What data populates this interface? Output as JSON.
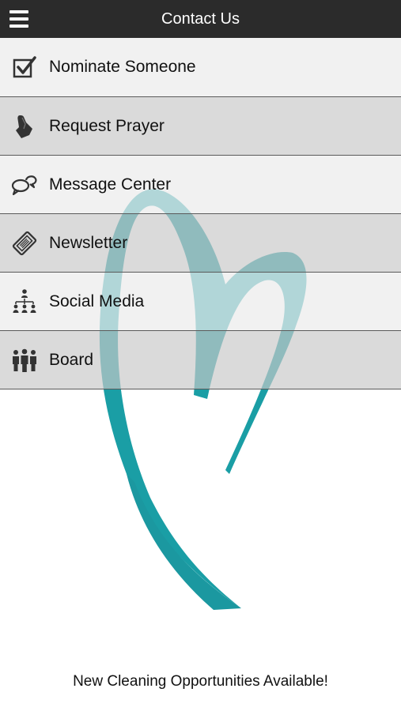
{
  "header": {
    "title": "Contact Us",
    "menu_icon": "hamburger-menu-icon"
  },
  "menu": {
    "items": [
      {
        "label": "Nominate Someone",
        "icon": "checkbox-check-icon"
      },
      {
        "label": "Request Prayer",
        "icon": "praying-hands-icon"
      },
      {
        "label": "Message Center",
        "icon": "chat-bubbles-icon"
      },
      {
        "label": "Newsletter",
        "icon": "ticket-icon"
      },
      {
        "label": "Social Media",
        "icon": "org-network-icon"
      },
      {
        "label": "Board",
        "icon": "people-group-icon"
      }
    ]
  },
  "footer": {
    "text": "New Cleaning Opportunities Available!"
  },
  "colors": {
    "header_bg": "#2b2b2b",
    "accent_teal": "#1a9ea5"
  }
}
